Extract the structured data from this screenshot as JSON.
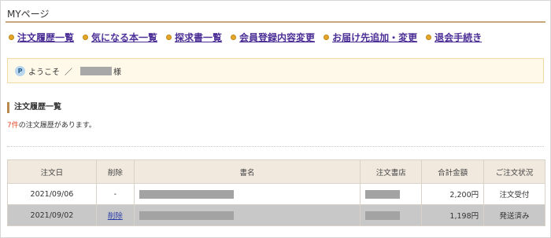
{
  "page": {
    "title": "MYページ"
  },
  "nav": {
    "items": [
      {
        "label": "注文履歴一覧"
      },
      {
        "label": "気になる本一覧"
      },
      {
        "label": "探求書一覧"
      },
      {
        "label": "会員登録内容変更"
      },
      {
        "label": "お届け先追加・変更"
      },
      {
        "label": "退会手続き"
      }
    ],
    "bullet_color": "#e3a72a",
    "link_color": "#4b2f96"
  },
  "welcome": {
    "icon": "p-point-icon",
    "icon_letter": "P",
    "greeting": "ようこそ",
    "separator": "／",
    "honorific": "様"
  },
  "orders": {
    "heading": "注文履歴一覧",
    "count_number": "7件",
    "count_suffix": "の注文履歴があります。",
    "columns": [
      "注文日",
      "削除",
      "書名",
      "注文書店",
      "合計金額",
      "ご注文状況"
    ],
    "rows": [
      {
        "date": "2021/09/06",
        "delete": "-",
        "total": "2,200円",
        "status": "注文受付"
      },
      {
        "date": "2021/09/02",
        "delete": "削除",
        "total": "1,198円",
        "status": "発送済み"
      }
    ]
  }
}
